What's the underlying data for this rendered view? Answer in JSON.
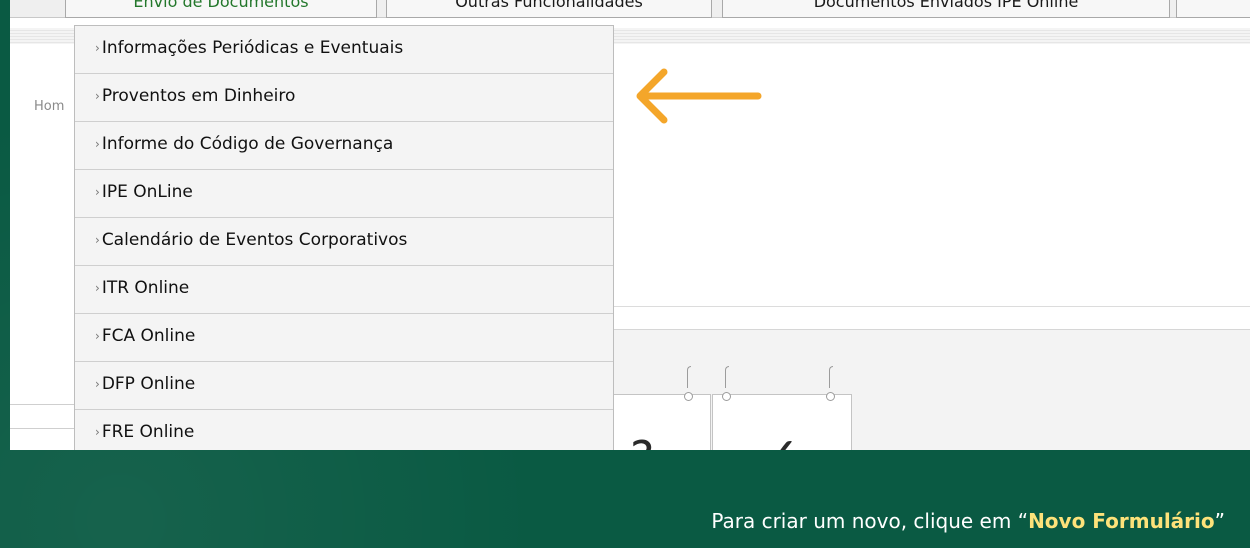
{
  "tabs": [
    {
      "label": "Envio de Documentos",
      "active": true
    },
    {
      "label": "Outras Funcionalidades",
      "active": false
    },
    {
      "label": "Documentos Enviados IPE Online",
      "active": false
    }
  ],
  "breadcrumb": "Hom",
  "menu": {
    "items": [
      {
        "label": "Informações Periódicas e Eventuais"
      },
      {
        "label": "Proventos em Dinheiro",
        "highlighted": true
      },
      {
        "label": "Informe do Código de Governança"
      },
      {
        "label": "IPE OnLine"
      },
      {
        "label": "Calendário de Eventos Corporativos"
      },
      {
        "label": "ITR Online"
      },
      {
        "label": "FCA Online"
      },
      {
        "label": "DFP Online"
      },
      {
        "label": "FRE Online"
      }
    ],
    "chevron": "›"
  },
  "annotation": {
    "arrow_color": "#f4a62a",
    "direction": "left"
  },
  "caption": {
    "before": "Para criar um novo, clique em “",
    "emphasis": "Novo Formulário",
    "after": "”"
  },
  "colors": {
    "background": "#0a5a43",
    "active_tab_text": "#23772b",
    "caption_emphasis": "#fde27a"
  }
}
